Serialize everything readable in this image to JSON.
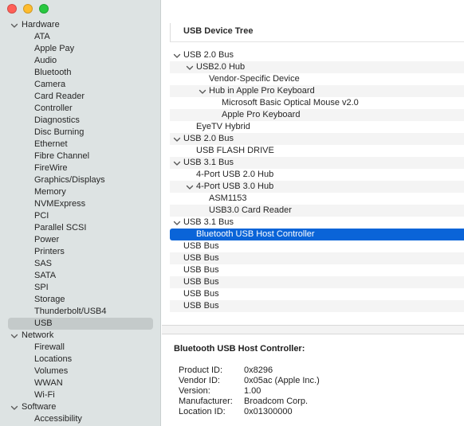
{
  "window": {
    "controls": [
      "close",
      "minimize",
      "zoom"
    ]
  },
  "sidebar": {
    "sections": [
      {
        "label": "Hardware",
        "items": [
          "ATA",
          "Apple Pay",
          "Audio",
          "Bluetooth",
          "Camera",
          "Card Reader",
          "Controller",
          "Diagnostics",
          "Disc Burning",
          "Ethernet",
          "Fibre Channel",
          "FireWire",
          "Graphics/Displays",
          "Memory",
          "NVMExpress",
          "PCI",
          "Parallel SCSI",
          "Power",
          "Printers",
          "SAS",
          "SATA",
          "SPI",
          "Storage",
          "Thunderbolt/USB4",
          "USB"
        ]
      },
      {
        "label": "Network",
        "items": [
          "Firewall",
          "Locations",
          "Volumes",
          "WWAN",
          "Wi-Fi"
        ]
      },
      {
        "label": "Software",
        "items": [
          "Accessibility"
        ]
      }
    ],
    "selected": "USB"
  },
  "device_tree": {
    "header": "USB Device Tree",
    "rows": [
      {
        "label": "USB 2.0 Bus",
        "level": 0,
        "expandable": true
      },
      {
        "label": "USB2.0 Hub",
        "level": 1,
        "expandable": true
      },
      {
        "label": "Vendor-Specific Device",
        "level": 2,
        "expandable": false
      },
      {
        "label": "Hub in Apple Pro Keyboard",
        "level": 2,
        "expandable": true
      },
      {
        "label": "Microsoft Basic Optical Mouse v2.0",
        "level": 3,
        "expandable": false
      },
      {
        "label": "Apple Pro Keyboard",
        "level": 3,
        "expandable": false
      },
      {
        "label": "EyeTV Hybrid",
        "level": 1,
        "expandable": false
      },
      {
        "label": "USB 2.0 Bus",
        "level": 0,
        "expandable": true
      },
      {
        "label": "USB FLASH DRIVE",
        "level": 1,
        "expandable": false
      },
      {
        "label": "USB 3.1 Bus",
        "level": 0,
        "expandable": true
      },
      {
        "label": "4-Port USB 2.0 Hub",
        "level": 1,
        "expandable": false
      },
      {
        "label": "4-Port USB 3.0 Hub",
        "level": 1,
        "expandable": true
      },
      {
        "label": "ASM1153",
        "level": 2,
        "expandable": false
      },
      {
        "label": "USB3.0 Card Reader",
        "level": 2,
        "expandable": false
      },
      {
        "label": "USB 3.1 Bus",
        "level": 0,
        "expandable": true
      },
      {
        "label": "Bluetooth USB Host Controller",
        "level": 1,
        "expandable": false,
        "selected": true
      },
      {
        "label": "USB Bus",
        "level": 0,
        "expandable": false
      },
      {
        "label": "USB Bus",
        "level": 0,
        "expandable": false
      },
      {
        "label": "USB Bus",
        "level": 0,
        "expandable": false
      },
      {
        "label": "USB Bus",
        "level": 0,
        "expandable": false
      },
      {
        "label": "USB Bus",
        "level": 0,
        "expandable": false
      },
      {
        "label": "USB Bus",
        "level": 0,
        "expandable": false
      }
    ]
  },
  "details": {
    "title": "Bluetooth USB Host Controller:",
    "properties": [
      {
        "key": "Product ID:",
        "value": "0x8296"
      },
      {
        "key": "Vendor ID:",
        "value": "0x05ac (Apple Inc.)"
      },
      {
        "key": "Version:",
        "value": "1.00"
      },
      {
        "key": "Manufacturer:",
        "value": "Broadcom Corp."
      },
      {
        "key": "Location ID:",
        "value": "0x01300000"
      }
    ]
  },
  "colors": {
    "sidebar_bg": "#dde3e3",
    "sidebar_selected": "#c4caca",
    "row_selected": "#0a64d8",
    "close": "#ff5f57",
    "minimize": "#febc2e",
    "zoom": "#28c840"
  }
}
